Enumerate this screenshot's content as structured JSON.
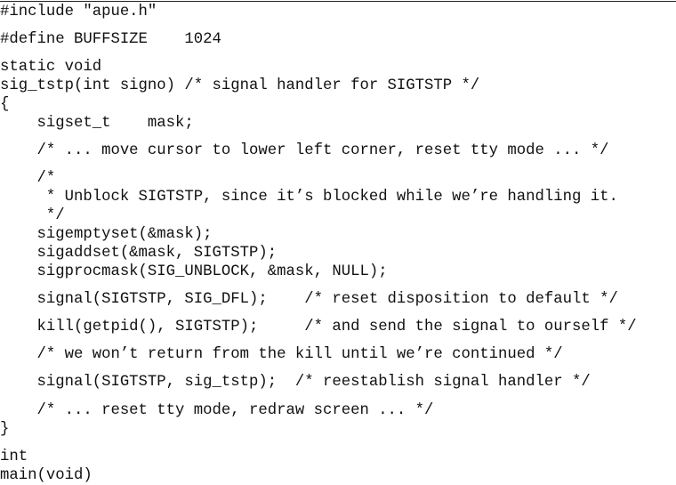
{
  "lines": [
    "#include \"apue.h\"",
    "#define BUFFSIZE    1024",
    "static void",
    "sig_tstp(int signo) /* signal handler for SIGTSTP */",
    "{",
    "    sigset_t    mask;",
    "    /* ... move cursor to lower left corner, reset tty mode ... */",
    "    /*",
    "     * Unblock SIGTSTP, since it’s blocked while we’re handling it.",
    "     */",
    "    sigemptyset(&mask);",
    "    sigaddset(&mask, SIGTSTP);",
    "    sigprocmask(SIG_UNBLOCK, &mask, NULL);",
    "    signal(SIGTSTP, SIG_DFL);    /* reset disposition to default */",
    "    kill(getpid(), SIGTSTP);     /* and send the signal to ourself */",
    "    /* we won’t return from the kill until we’re continued */",
    "    signal(SIGTSTP, sig_tstp);  /* reestablish signal handler */",
    "    /* ... reset tty mode, redraw screen ... */",
    "}",
    "int",
    "main(void)"
  ]
}
